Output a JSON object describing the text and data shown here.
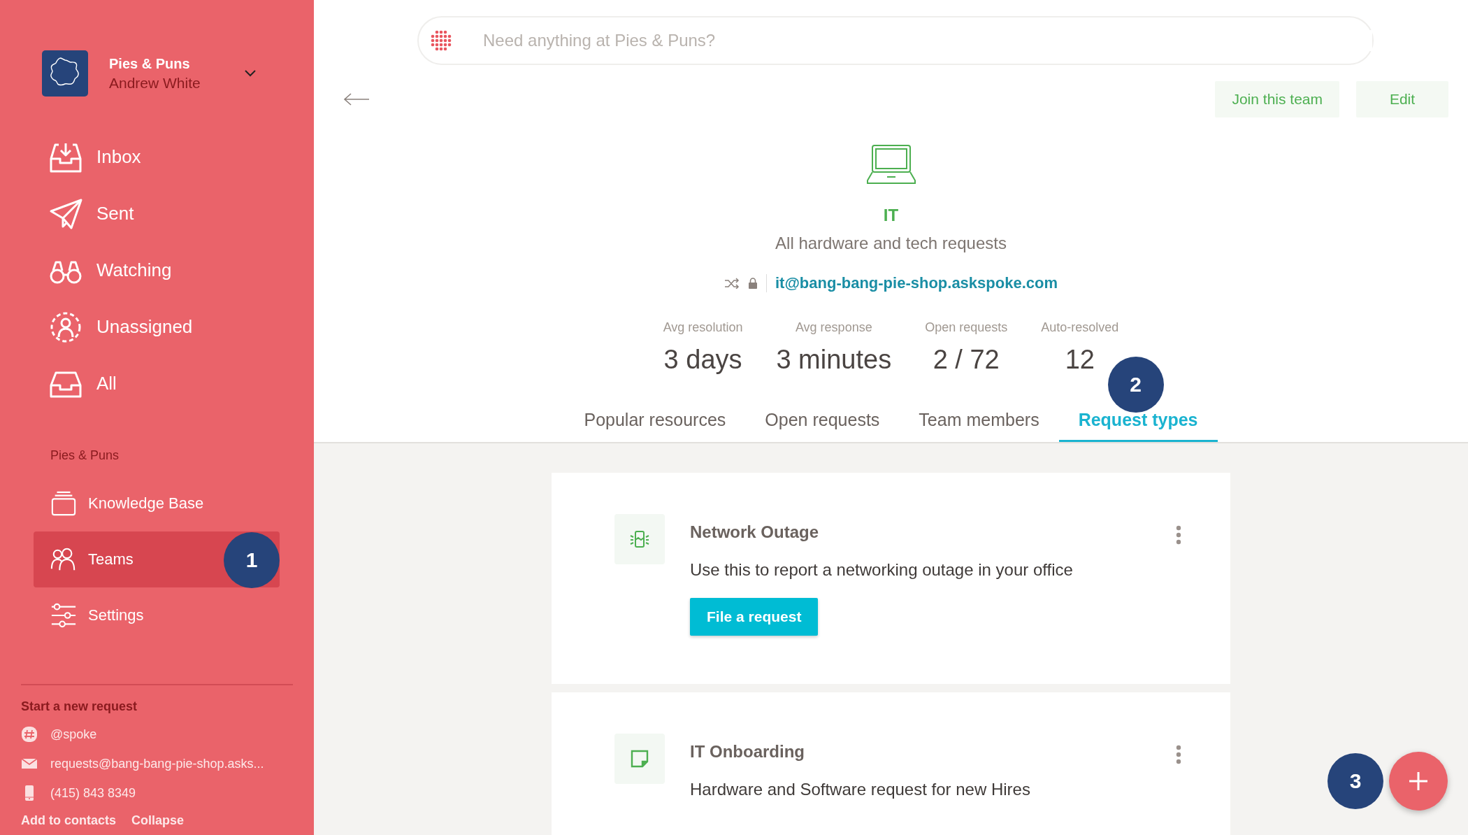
{
  "workspace": {
    "name": "Pies & Puns",
    "user": "Andrew White"
  },
  "nav": [
    {
      "kind": "inbox",
      "label": "Inbox",
      "selected": false
    },
    {
      "kind": "sent",
      "label": "Sent",
      "selected": false
    },
    {
      "kind": "watching",
      "label": "Watching",
      "selected": false
    },
    {
      "kind": "unassigned",
      "label": "Unassigned",
      "selected": false
    },
    {
      "kind": "all",
      "label": "All",
      "selected": false
    }
  ],
  "section_label": "Pies & Puns",
  "section_nav": [
    {
      "kind": "knowledge",
      "label": "Knowledge Base",
      "selected": false
    },
    {
      "kind": "teams",
      "label": "Teams",
      "selected": true,
      "step": "1"
    },
    {
      "kind": "settings",
      "label": "Settings",
      "selected": false
    }
  ],
  "new_request": {
    "title": "Start a new request",
    "channels": [
      {
        "kind": "slack",
        "text": "@spoke"
      },
      {
        "kind": "email",
        "text": "requests@bang-bang-pie-shop.asks..."
      },
      {
        "kind": "phone",
        "text": "(415) 843 8349"
      }
    ],
    "links": [
      "Add to contacts",
      "Collapse"
    ]
  },
  "search": {
    "placeholder": "Need anything at Pies & Puns?"
  },
  "actions": [
    "Join this team",
    "Edit"
  ],
  "team": {
    "name": "IT",
    "description": "All hardware and tech requests",
    "email": "it@bang-bang-pie-shop.askspoke.com"
  },
  "stats": [
    {
      "label": "Avg resolution",
      "value": "3 days"
    },
    {
      "label": "Avg response",
      "value": "3 minutes"
    },
    {
      "label": "Open requests",
      "value": "2 / 72"
    },
    {
      "label": "Auto-resolved",
      "value": "12"
    }
  ],
  "tabs": [
    {
      "label": "Popular resources",
      "selected": false
    },
    {
      "label": "Open requests",
      "selected": false
    },
    {
      "label": "Team members",
      "selected": false
    },
    {
      "label": "Request types",
      "selected": true,
      "step": "2"
    }
  ],
  "request_types": [
    {
      "kind": "network",
      "title": "Network Outage",
      "description": "Use this to report a networking outage in your office",
      "button": "File a request"
    },
    {
      "kind": "onboarding",
      "title": "IT Onboarding",
      "description": "Hardware and Software request for new Hires"
    }
  ],
  "fab_step": "3"
}
